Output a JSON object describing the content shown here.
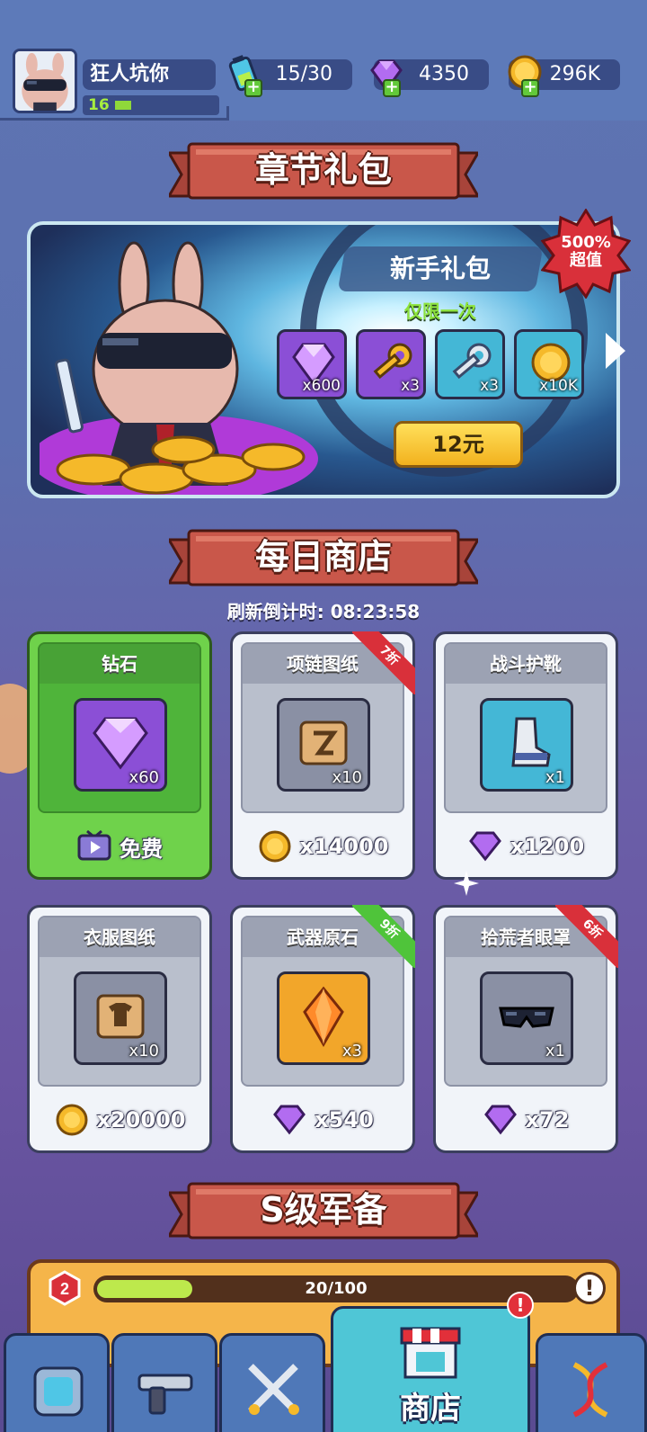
{
  "player": {
    "name": "狂人坑你",
    "level": "16",
    "level_progress": 0.12
  },
  "resources": {
    "energy": "15/30",
    "gems": "4350",
    "coins": "296K"
  },
  "chapter_pack": {
    "banner": "章节礼包",
    "title": "新手礼包",
    "subtitle": "仅限一次",
    "badge": "500%\n超值",
    "badge_line1": "500%",
    "badge_line2": "超值",
    "items": [
      {
        "icon": "gem-icon",
        "qty": "x600"
      },
      {
        "icon": "gold-key-icon",
        "qty": "x3"
      },
      {
        "icon": "silver-key-icon",
        "qty": "x3"
      },
      {
        "icon": "coin-icon",
        "qty": "x10K"
      }
    ],
    "price": "12元"
  },
  "daily_shop": {
    "banner": "每日商店",
    "countdown": "刷新倒计时: 08:23:58",
    "items": [
      {
        "name": "钻石",
        "qty": "x60",
        "cost_label": "免费",
        "cost_icon": "tv-ad-icon",
        "discount": ""
      },
      {
        "name": "项链图纸",
        "qty": "x10",
        "cost_label": "x14000",
        "cost_icon": "coin-icon",
        "discount": "7折"
      },
      {
        "name": "战斗护靴",
        "qty": "x1",
        "cost_label": "x1200",
        "cost_icon": "gem-icon",
        "discount": ""
      },
      {
        "name": "衣服图纸",
        "qty": "x10",
        "cost_label": "x20000",
        "cost_icon": "coin-icon",
        "discount": ""
      },
      {
        "name": "武器原石",
        "qty": "x3",
        "cost_label": "x540",
        "cost_icon": "gem-icon",
        "discount": "9折"
      },
      {
        "name": "拾荒者眼罩",
        "qty": "x1",
        "cost_label": "x72",
        "cost_icon": "gem-icon",
        "discount": "6折"
      }
    ]
  },
  "s_grade": {
    "banner": "S级军备",
    "rank": "2",
    "progress_text": "20/100",
    "progress": 0.2,
    "info": "!"
  },
  "nav": {
    "tabs": [
      {
        "icon": "armor-icon",
        "label": ""
      },
      {
        "icon": "gun-icon",
        "label": ""
      },
      {
        "icon": "crossed-swords-icon",
        "label": ""
      },
      {
        "icon": "shop-icon",
        "label": "商店",
        "active": true,
        "alert": "!"
      },
      {
        "icon": "dna-icon",
        "label": ""
      }
    ]
  },
  "colors": {
    "gem": "#b26cf0",
    "coin": "#f5b92a",
    "discount_red": "#d9303a",
    "discount_green": "#4fc43a",
    "green_card": "#6fd24b"
  }
}
